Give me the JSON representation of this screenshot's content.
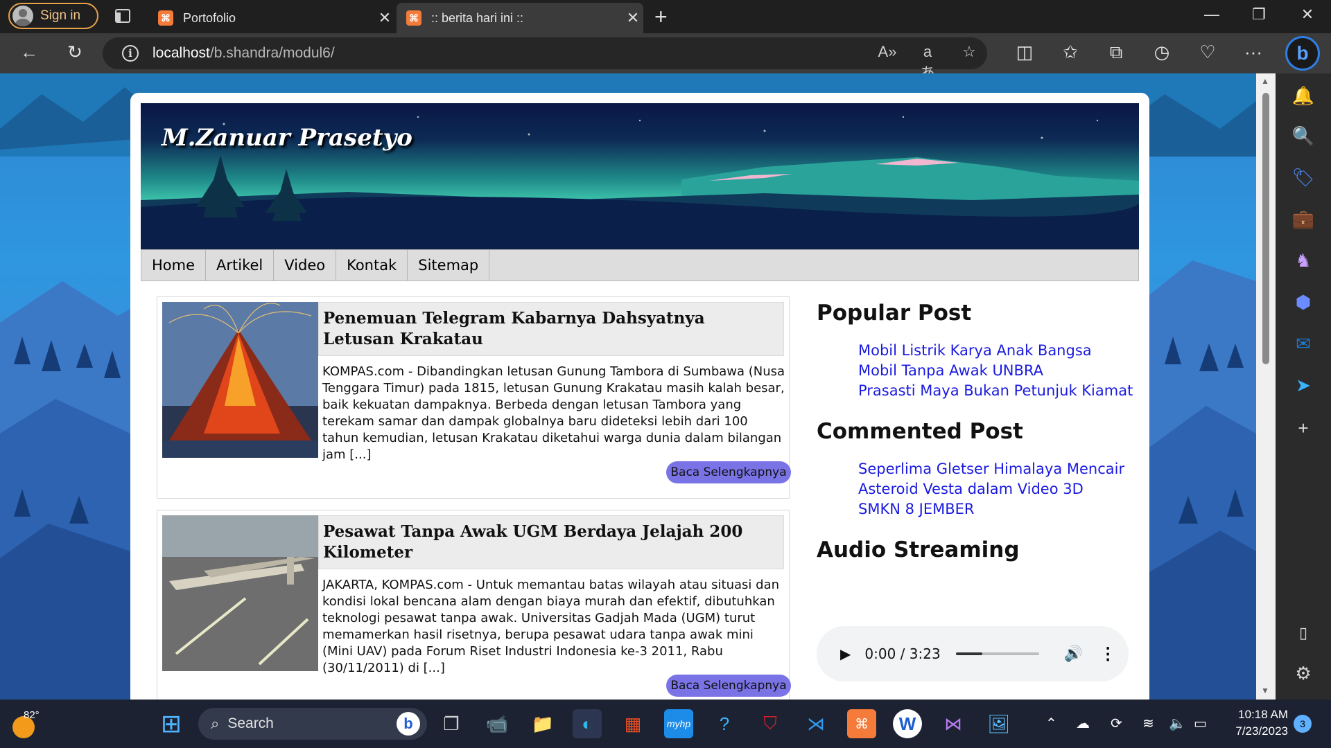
{
  "browser": {
    "signin_label": "Sign in",
    "tabs": [
      {
        "title": "Portofolio",
        "close": "✕"
      },
      {
        "title": ":: berita hari ini ::",
        "close": "✕"
      }
    ],
    "new_tab": "+",
    "url_host": "localhost",
    "url_path": "/b.shandra/modul6/",
    "window_controls": {
      "minimize": "—",
      "maximize": "❐",
      "close": "✕"
    }
  },
  "site": {
    "title": "M.Zanuar Prasetyo",
    "nav": [
      "Home",
      "Artikel",
      "Video",
      "Kontak",
      "Sitemap"
    ],
    "posts": [
      {
        "title": "Penemuan Telegram Kabarnya Dahsyatnya Letusan Krakatau",
        "body": "KOMPAS.com - Dibandingkan letusan Gunung Tambora di Sumbawa (Nusa Tenggara Timur) pada 1815, letusan Gunung Krakatau masih kalah besar, baik kekuatan dampaknya. Berbeda dengan letusan Tambora yang terekam samar dan dampak globalnya baru dideteksi lebih dari 100 tahun kemudian, letusan Krakatau diketahui warga dunia dalam bilangan jam [...]",
        "more": "Baca Selengkapnya"
      },
      {
        "title": "Pesawat Tanpa Awak UGM Berdaya Jelajah 200 Kilometer",
        "body": "JAKARTA, KOMPAS.com - Untuk memantau batas wilayah atau situasi dan kondisi lokal bencana alam dengan biaya murah dan efektif, dibutuhkan teknologi pesawat tanpa awak. Universitas Gadjah Mada (UGM) turut memamerkan hasil risetnya, berupa pesawat udara tanpa awak mini (Mini UAV) pada Forum Riset Industri Indonesia ke-3 2011, Rabu (30/11/2011) di [...]",
        "more": "Baca Selengkapnya"
      }
    ],
    "sidebar": {
      "popular_title": "Popular Post",
      "popular": [
        "Mobil Listrik Karya Anak Bangsa",
        "Mobil Tanpa Awak UNBRA",
        "Prasasti Maya Bukan Petunjuk Kiamat"
      ],
      "commented_title": "Commented Post",
      "commented": [
        "Seperlima Gletser Himalaya Mencair",
        "Asteroid Vesta dalam Video 3D",
        "SMKN 8 JEMBER"
      ],
      "audio_title": "Audio Streaming",
      "audio_time": "0:00 / 3:23",
      "audio_progress": 0.32
    }
  },
  "taskbar": {
    "temperature": "82°",
    "search_placeholder": "Search",
    "time": "10:18 AM",
    "date": "7/23/2023",
    "notifications": "3"
  },
  "colors": {
    "accent_button": "#7a73e6",
    "link": "#1a1ae0",
    "header_teal": "#48d8b6",
    "signin_border": "#e8a24a"
  }
}
